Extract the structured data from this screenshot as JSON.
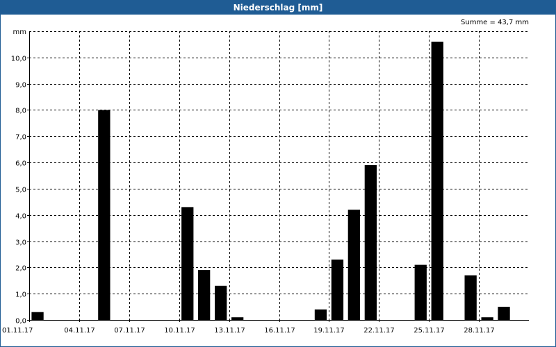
{
  "window": {
    "title": "Niederschlag [mm]"
  },
  "summary": {
    "text": "Summe = 43,7 mm"
  },
  "colors": {
    "titlebar": "#1f5c94",
    "bar": "#000000",
    "grid": "#000000"
  },
  "chart_data": {
    "type": "bar",
    "title": "Niederschlag [mm]",
    "ylabel": "mm",
    "ylim": [
      0,
      11
    ],
    "grid": true,
    "categories": [
      "01.11.17",
      "02.11.17",
      "03.11.17",
      "04.11.17",
      "05.11.17",
      "06.11.17",
      "07.11.17",
      "08.11.17",
      "09.11.17",
      "10.11.17",
      "11.11.17",
      "12.11.17",
      "13.11.17",
      "14.11.17",
      "15.11.17",
      "16.11.17",
      "17.11.17",
      "18.11.17",
      "19.11.17",
      "20.11.17",
      "21.11.17",
      "22.11.17",
      "23.11.17",
      "24.11.17",
      "25.11.17",
      "26.11.17",
      "27.11.17",
      "28.11.17",
      "29.11.17",
      "30.11.17"
    ],
    "values": [
      0.3,
      0,
      0,
      0,
      8.0,
      0,
      0,
      0,
      0,
      4.3,
      1.9,
      1.3,
      0.1,
      0,
      0,
      0,
      0,
      0.4,
      2.3,
      4.2,
      5.9,
      0,
      0,
      2.1,
      10.6,
      0,
      1.7,
      0.1,
      0.5,
      0
    ],
    "xticks": [
      "01.11.17",
      "04.11.17",
      "07.11.17",
      "10.11.17",
      "13.11.17",
      "16.11.17",
      "19.11.17",
      "22.11.17",
      "25.11.17",
      "28.11.17"
    ],
    "yticks": [
      "0,0",
      "1,0",
      "2,0",
      "3,0",
      "4,0",
      "5,0",
      "6,0",
      "7,0",
      "8,0",
      "9,0",
      "10,0"
    ],
    "ytick_values": [
      0,
      1,
      2,
      3,
      4,
      5,
      6,
      7,
      8,
      9,
      10
    ]
  }
}
